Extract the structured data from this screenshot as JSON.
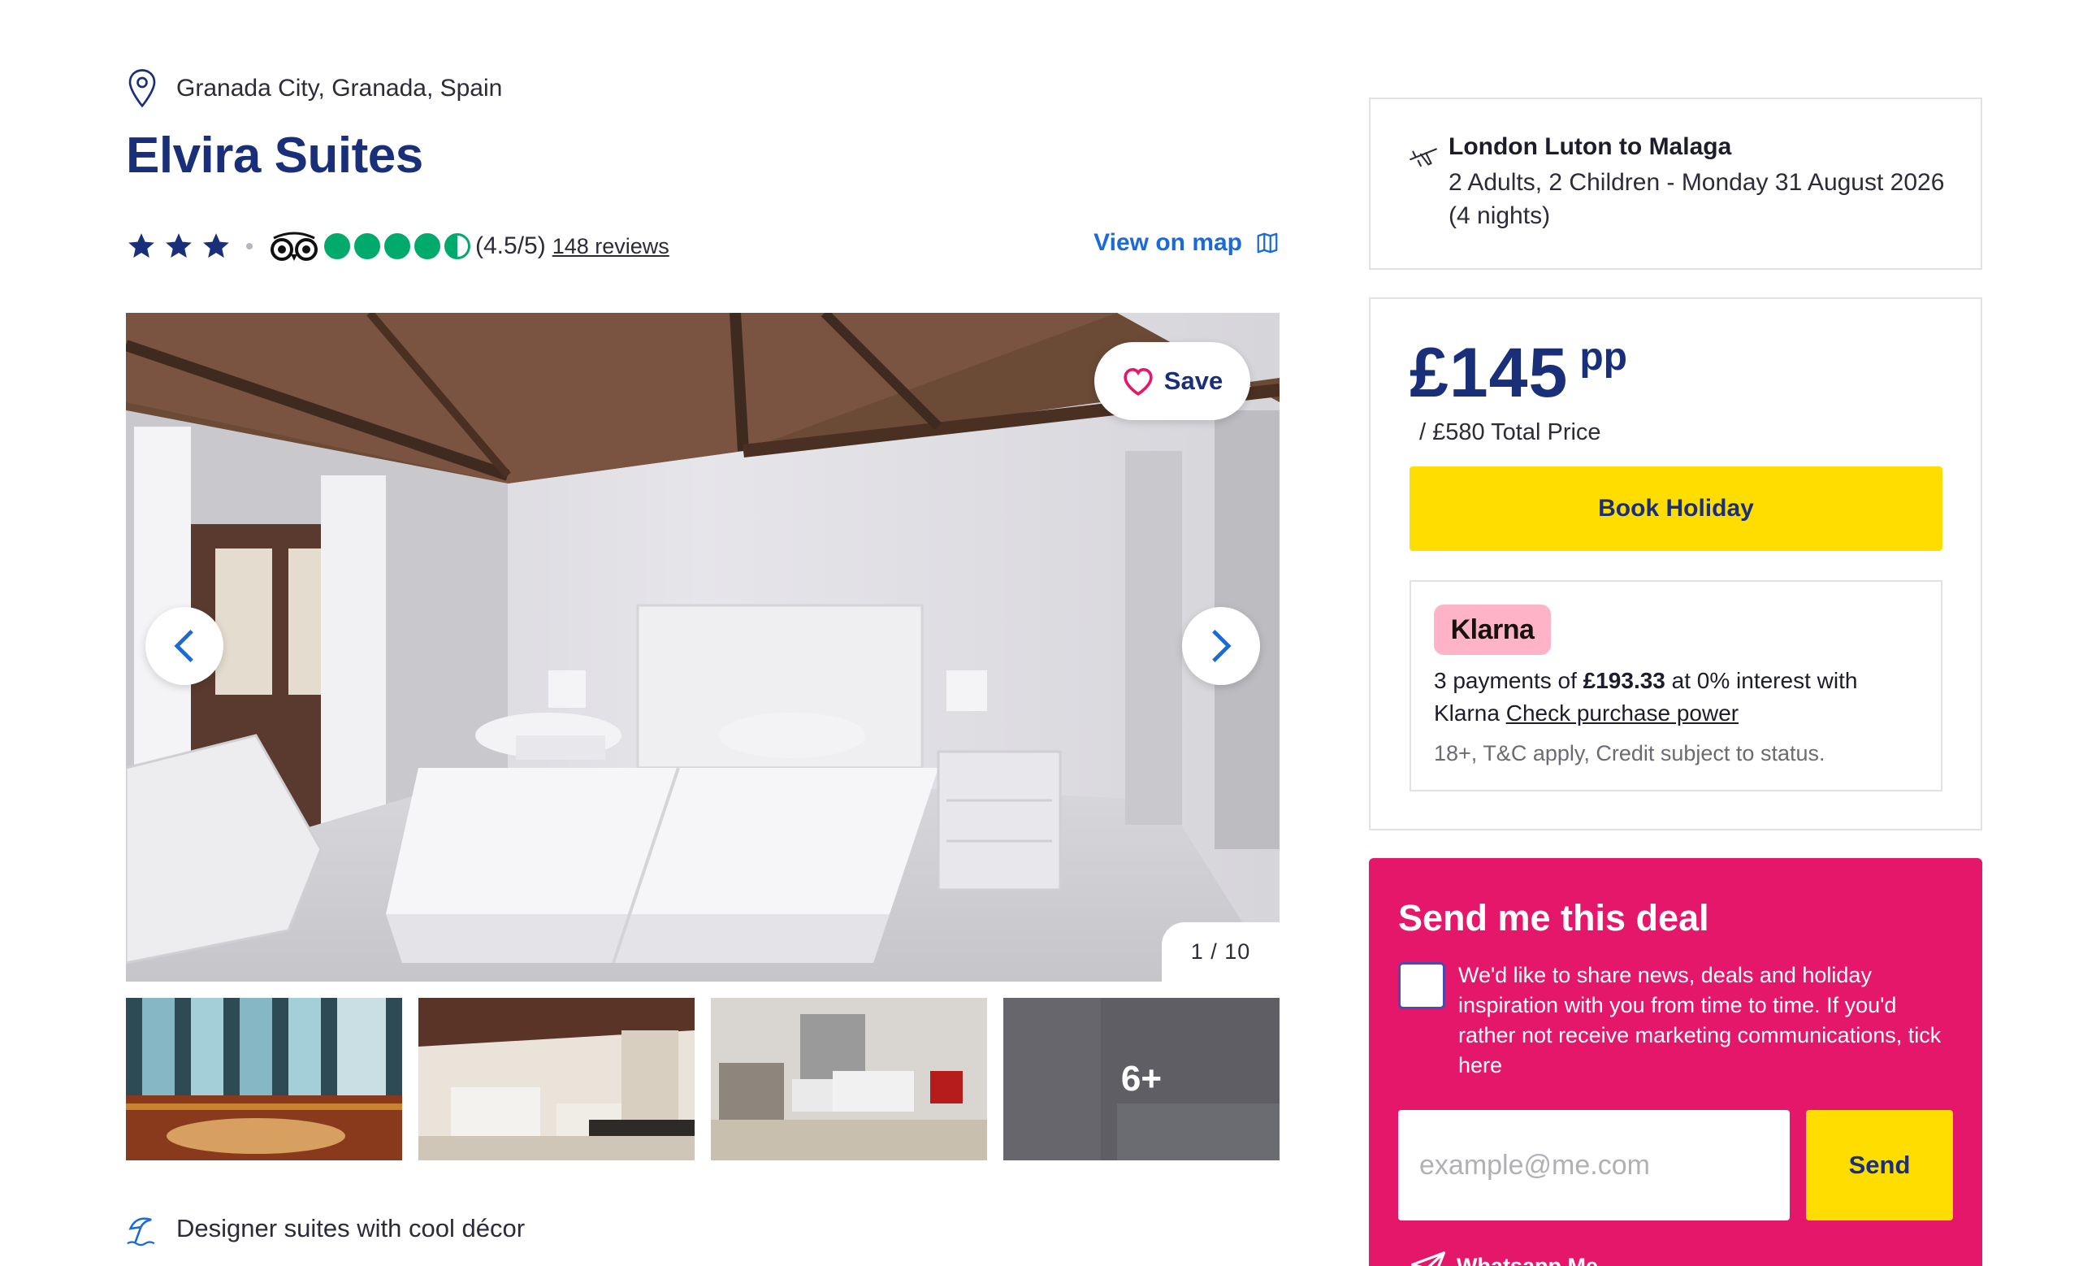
{
  "location": {
    "text": "Granada City, Granada, Spain",
    "icon": "map-pin-icon"
  },
  "hotel": {
    "name": "Elvira Suites",
    "star_rating": 3
  },
  "tripadvisor": {
    "bubble_score": 4.5,
    "rating_text": "(4.5/5)",
    "reviews_link": "148 reviews"
  },
  "map": {
    "label": "View on map",
    "icon": "map-icon"
  },
  "gallery": {
    "save_label": "Save",
    "counter": "1 / 10",
    "more_label": "6+",
    "thumbnails": [
      "thumbnail-1",
      "thumbnail-2",
      "thumbnail-3",
      "thumbnail-more"
    ]
  },
  "feature": {
    "text": "Designer suites with cool décor",
    "icon": "beach-umbrella-icon"
  },
  "flight": {
    "route": "London Luton to Malaga",
    "details": "2 Adults, 2 Children - Monday 31 August 2026 (4 nights)"
  },
  "price": {
    "per_person": "£145",
    "unit": "pp",
    "total": "/ £580 Total Price",
    "book_label": "Book Holiday"
  },
  "klarna": {
    "badge": "Klarna",
    "text_before": "3 payments of ",
    "amount": "£193.33",
    "text_after": " at 0% interest with Klarna ",
    "link": "Check purchase power",
    "small_print": "18+, T&C apply, Credit subject to status."
  },
  "deal": {
    "title": "Send me this deal",
    "consent": "We'd like to share news, deals and holiday inspiration with you from time to time. If you'd rather not receive marketing communications, tick here",
    "email_placeholder": "example@me.com",
    "send_label": "Send",
    "whatsapp_label": "Whatsapp Me"
  },
  "colors": {
    "brand_navy": "#1a2f7a",
    "link_blue": "#1a6ad8",
    "cta_yellow": "#ffdd00",
    "deal_pink": "#e5176b",
    "tripadvisor_green": "#00aa6c",
    "klarna_pink": "#ffb3c7"
  }
}
